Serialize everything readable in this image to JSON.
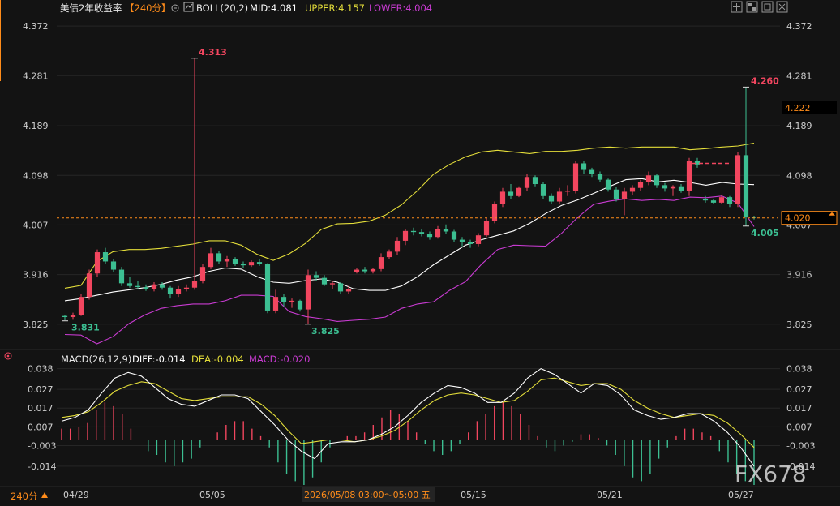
{
  "header": {
    "instrument": "美债2年收益率",
    "period": "【240分】",
    "boll": "BOLL(20,2)",
    "mid": "MID:4.081",
    "upper": "UPPER:4.157",
    "lower": "LOWER:4.004"
  },
  "macd_header": {
    "name": "MACD(26,12,9)",
    "diff": "DIFF:-0.014",
    "dea": "DEA:-0.004",
    "macd": "MACD:-0.020"
  },
  "footer": {
    "period_button": "240分",
    "crosshair_time": "2026/05/08 03:00～05:00 五",
    "watermark": "FX678"
  },
  "colors": {
    "up": "#f2465f",
    "down": "#3cbf92",
    "mid": "#ffffff",
    "upper": "#e4de3a",
    "lower": "#c93bd2",
    "current": "#ff8c1a"
  },
  "chart_data": [
    {
      "type": "candlestick",
      "yticks": [
        "4.372",
        "4.281",
        "4.189",
        "4.098",
        "4.007",
        "3.916",
        "3.825"
      ],
      "ylim": [
        3.78,
        4.39
      ],
      "xticks": [
        "04/29",
        "05/05",
        "05/15",
        "05/21",
        "05/27"
      ],
      "current_price": "4.020",
      "pending_level": "4.222",
      "annotations": {
        "high_1": "4.313",
        "high_2": "4.260",
        "low_1": "3.831",
        "low_2": "3.825",
        "low_3": "4.005"
      },
      "ohlc": [
        [
          3.84,
          3.842,
          3.832,
          3.838
        ],
        [
          3.838,
          3.846,
          3.833,
          3.842
        ],
        [
          3.842,
          3.88,
          3.84,
          3.875
        ],
        [
          3.875,
          3.925,
          3.87,
          3.918
        ],
        [
          3.918,
          3.962,
          3.912,
          3.957
        ],
        [
          3.957,
          3.965,
          3.935,
          3.94
        ],
        [
          3.94,
          3.945,
          3.92,
          3.925
        ],
        [
          3.925,
          3.93,
          3.895,
          3.9
        ],
        [
          3.9,
          3.912,
          3.892,
          3.895
        ],
        [
          3.895,
          3.905,
          3.89,
          3.893
        ],
        [
          3.893,
          3.898,
          3.886,
          3.89
        ],
        [
          3.89,
          3.902,
          3.885,
          3.898
        ],
        [
          3.898,
          3.902,
          3.888,
          3.892
        ],
        [
          3.892,
          3.895,
          3.872,
          3.88
        ],
        [
          3.88,
          3.895,
          3.875,
          3.889
        ],
        [
          3.889,
          3.898,
          3.885,
          3.892
        ],
        [
          3.892,
          4.313,
          3.888,
          3.905
        ],
        [
          3.905,
          3.935,
          3.9,
          3.93
        ],
        [
          3.93,
          3.965,
          3.926,
          3.955
        ],
        [
          3.955,
          3.96,
          3.935,
          3.94
        ],
        [
          3.94,
          3.95,
          3.93,
          3.944
        ],
        [
          3.944,
          3.948,
          3.932,
          3.936
        ],
        [
          3.936,
          3.94,
          3.928,
          3.933
        ],
        [
          3.933,
          3.942,
          3.93,
          3.939
        ],
        [
          3.939,
          3.944,
          3.932,
          3.935
        ],
        [
          3.935,
          3.937,
          3.845,
          3.85
        ],
        [
          3.85,
          3.888,
          3.845,
          3.875
        ],
        [
          3.875,
          3.88,
          3.858,
          3.865
        ],
        [
          3.865,
          3.872,
          3.855,
          3.868
        ],
        [
          3.868,
          3.87,
          3.848,
          3.852
        ],
        [
          3.852,
          3.925,
          3.825,
          3.915
        ],
        [
          3.915,
          3.922,
          3.905,
          3.91
        ],
        [
          3.91,
          3.915,
          3.895,
          3.898
        ],
        [
          3.898,
          3.905,
          3.89,
          3.9
        ],
        [
          3.9,
          3.902,
          3.88,
          3.885
        ],
        [
          3.885,
          3.895,
          3.88,
          3.89
        ],
        [
          3.921,
          3.928,
          3.918,
          3.925
        ],
        [
          3.925,
          3.93,
          3.918,
          3.922
        ],
        [
          3.922,
          3.928,
          3.918,
          3.926
        ],
        [
          3.926,
          3.955,
          3.922,
          3.948
        ],
        [
          3.948,
          3.962,
          3.944,
          3.958
        ],
        [
          3.958,
          3.985,
          3.952,
          3.978
        ],
        [
          3.978,
          4.0,
          3.97,
          3.996
        ],
        [
          3.996,
          4.002,
          3.988,
          3.994
        ],
        [
          3.994,
          3.999,
          3.986,
          3.99
        ],
        [
          3.99,
          3.995,
          3.98,
          3.985
        ],
        [
          3.985,
          4.005,
          3.982,
          4.0
        ],
        [
          4.0,
          4.008,
          3.99,
          3.995
        ],
        [
          3.995,
          3.998,
          3.975,
          3.98
        ],
        [
          3.98,
          3.985,
          3.968,
          3.975
        ],
        [
          3.975,
          3.98,
          3.965,
          3.972
        ],
        [
          3.972,
          3.992,
          3.968,
          3.988
        ],
        [
          3.988,
          4.02,
          3.985,
          4.015
        ],
        [
          4.015,
          4.05,
          4.01,
          4.045
        ],
        [
          4.045,
          4.075,
          4.04,
          4.068
        ],
        [
          4.068,
          4.082,
          4.055,
          4.06
        ],
        [
          4.06,
          4.078,
          4.058,
          4.075
        ],
        [
          4.075,
          4.1,
          4.07,
          4.095
        ],
        [
          4.095,
          4.098,
          4.078,
          4.082
        ],
        [
          4.082,
          4.085,
          4.055,
          4.06
        ],
        [
          4.06,
          4.065,
          4.045,
          4.05
        ],
        [
          4.05,
          4.075,
          4.045,
          4.068
        ],
        [
          4.068,
          4.08,
          4.06,
          4.07
        ],
        [
          4.07,
          4.125,
          4.065,
          4.12
        ],
        [
          4.12,
          4.125,
          4.1,
          4.108
        ],
        [
          4.108,
          4.112,
          4.095,
          4.1
        ],
        [
          4.1,
          4.105,
          4.085,
          4.09
        ],
        [
          4.09,
          4.092,
          4.068,
          4.072
        ],
        [
          4.072,
          4.076,
          4.05,
          4.055
        ],
        [
          4.055,
          4.075,
          4.025,
          4.068
        ],
        [
          4.068,
          4.08,
          4.062,
          4.075
        ],
        [
          4.075,
          4.09,
          4.07,
          4.085
        ],
        [
          4.085,
          4.105,
          4.08,
          4.098
        ],
        [
          4.098,
          4.1,
          4.075,
          4.08
        ],
        [
          4.08,
          4.084,
          4.068,
          4.074
        ],
        [
          4.074,
          4.08,
          4.06,
          4.078
        ],
        [
          4.078,
          4.082,
          4.066,
          4.07
        ],
        [
          4.07,
          4.13,
          4.06,
          4.125
        ],
        [
          4.125,
          4.13,
          4.112,
          4.118
        ],
        [
          4.055,
          4.06,
          4.048,
          4.052
        ],
        [
          4.052,
          4.055,
          4.045,
          4.048
        ],
        [
          4.048,
          4.062,
          4.045,
          4.058
        ],
        [
          4.058,
          4.06,
          4.04,
          4.045
        ],
        [
          4.045,
          4.14,
          4.04,
          4.135
        ],
        [
          4.135,
          4.26,
          4.005,
          4.022
        ],
        [
          4.022,
          4.024,
          4.017,
          4.02
        ]
      ],
      "mid": [
        3.868,
        3.872,
        3.878,
        3.884,
        3.888,
        3.892,
        3.898,
        3.906,
        3.912,
        3.922,
        3.928,
        3.926,
        3.912,
        3.902,
        3.9,
        3.905,
        3.908,
        3.902,
        3.89,
        3.887,
        3.887,
        3.895,
        3.912,
        3.934,
        3.952,
        3.97,
        3.98,
        3.988,
        3.996,
        4.01,
        4.028,
        4.043,
        4.053,
        4.065,
        4.078,
        4.09,
        4.092,
        4.086,
        4.089,
        4.085,
        4.08,
        4.085,
        4.082,
        4.081
      ],
      "upper": [
        3.891,
        3.896,
        3.94,
        3.958,
        3.962,
        3.962,
        3.964,
        3.968,
        3.972,
        3.978,
        3.978,
        3.97,
        3.953,
        3.942,
        3.954,
        3.973,
        3.999,
        4.009,
        4.01,
        4.014,
        4.025,
        4.044,
        4.07,
        4.1,
        4.118,
        4.132,
        4.141,
        4.144,
        4.141,
        4.138,
        4.142,
        4.142,
        4.144,
        4.148,
        4.15,
        4.148,
        4.15,
        4.15,
        4.15,
        4.145,
        4.147,
        4.15,
        4.152,
        4.157
      ],
      "lower": [
        3.806,
        3.805,
        3.789,
        3.802,
        3.826,
        3.842,
        3.854,
        3.859,
        3.862,
        3.862,
        3.868,
        3.878,
        3.878,
        3.876,
        3.848,
        3.839,
        3.835,
        3.83,
        3.832,
        3.834,
        3.838,
        3.854,
        3.862,
        3.866,
        3.887,
        3.903,
        3.935,
        3.962,
        3.97,
        3.969,
        3.968,
        3.992,
        4.021,
        4.045,
        4.051,
        4.055,
        4.052,
        4.054,
        4.052,
        4.058,
        4.057,
        4.06,
        4.047,
        4.004
      ]
    },
    {
      "type": "macd",
      "yticks": [
        "0.038",
        "0.027",
        "0.017",
        "0.007",
        "-0.003",
        "-0.014"
      ],
      "ylim": [
        -0.024,
        0.04
      ],
      "diff": [
        0.01,
        0.012,
        0.016,
        0.025,
        0.033,
        0.036,
        0.034,
        0.028,
        0.022,
        0.019,
        0.018,
        0.021,
        0.024,
        0.024,
        0.022,
        0.015,
        0.008,
        0.0,
        -0.006,
        -0.01,
        -0.002,
        -0.001,
        -0.001,
        0.0,
        0.003,
        0.007,
        0.013,
        0.02,
        0.025,
        0.029,
        0.028,
        0.025,
        0.02,
        0.02,
        0.025,
        0.033,
        0.038,
        0.035,
        0.03,
        0.025,
        0.03,
        0.029,
        0.024,
        0.016,
        0.013,
        0.011,
        0.012,
        0.014,
        0.014,
        0.01,
        0.004,
        -0.004,
        -0.014
      ],
      "dea": [
        0.012,
        0.013,
        0.015,
        0.02,
        0.026,
        0.029,
        0.031,
        0.03,
        0.026,
        0.022,
        0.021,
        0.022,
        0.023,
        0.023,
        0.023,
        0.019,
        0.013,
        0.005,
        -0.002,
        -0.001,
        0.0,
        0.0,
        -0.001,
        0.0,
        0.002,
        0.005,
        0.01,
        0.016,
        0.021,
        0.024,
        0.025,
        0.024,
        0.022,
        0.02,
        0.021,
        0.026,
        0.032,
        0.033,
        0.031,
        0.029,
        0.03,
        0.03,
        0.027,
        0.021,
        0.017,
        0.014,
        0.012,
        0.013,
        0.014,
        0.013,
        0.009,
        0.003,
        -0.004
      ],
      "macd": [
        0.006,
        0.006,
        0.007,
        0.009,
        0.016,
        0.02,
        0.018,
        0.014,
        0.006,
        0.0,
        -0.006,
        -0.008,
        -0.012,
        -0.014,
        -0.012,
        -0.01,
        -0.004,
        0.0,
        0.004,
        0.008,
        0.01,
        0.01,
        0.006,
        0.002,
        -0.004,
        -0.012,
        -0.018,
        -0.022,
        -0.024,
        -0.02,
        -0.012,
        -0.004,
        0.0,
        0.002,
        0.002,
        0.004,
        0.008,
        0.012,
        0.016,
        0.014,
        0.01,
        0.004,
        -0.002,
        -0.006,
        -0.008,
        -0.006,
        -0.002,
        0.004,
        0.01,
        0.014,
        0.018,
        0.02,
        0.018,
        0.014,
        0.008,
        0.002,
        -0.004,
        -0.006,
        -0.003,
        -0.001,
        0.003,
        0.003,
        0.001,
        -0.003,
        -0.008,
        -0.014,
        -0.02,
        -0.022,
        -0.018,
        -0.01,
        -0.004,
        0.002,
        0.006,
        0.006,
        0.004,
        0.002,
        -0.006,
        -0.012,
        -0.018,
        -0.022,
        -0.024
      ]
    }
  ]
}
